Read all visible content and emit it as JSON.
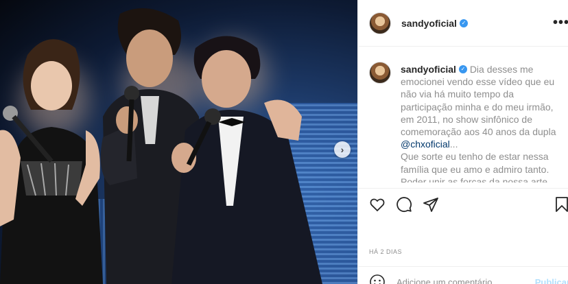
{
  "post": {
    "username": "sandyoficial",
    "verified_symbol": "✓",
    "more_symbol": "•••"
  },
  "caption": {
    "username": "sandyoficial",
    "line1": "Dia desses me emocionei vendo esse vídeo que eu não via há muito tempo da participação minha e do meu irmão, em 2011, no show sinfônico de comemoração aos 40 anos da dupla",
    "mention": "@chxoficial",
    "ellipsis": "...",
    "line2": "Que sorte eu tenho de estar nessa família que eu amo e admiro tanto. Poder unir as forças da nossa arte,"
  },
  "carousel": {
    "next_symbol": "›"
  },
  "meta": {
    "time_ago": "HÁ 2 DIAS"
  },
  "comment": {
    "placeholder": "Adicione um comentário...",
    "publish_label": "Publicar"
  },
  "icons": [
    "heart-icon",
    "comment-icon",
    "share-icon",
    "bookmark-icon",
    "emoji-icon"
  ],
  "colors": {
    "verified": "#3897f0",
    "mention": "#00376b",
    "publish": "#b2dffc"
  }
}
